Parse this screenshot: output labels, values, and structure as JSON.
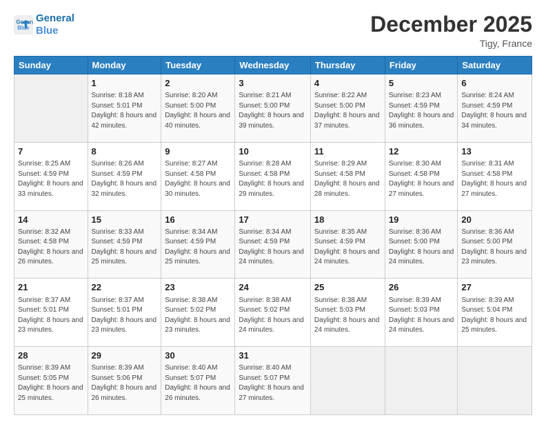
{
  "header": {
    "logo_line1": "General",
    "logo_line2": "Blue",
    "month": "December 2025",
    "location": "Tigy, France"
  },
  "weekdays": [
    "Sunday",
    "Monday",
    "Tuesday",
    "Wednesday",
    "Thursday",
    "Friday",
    "Saturday"
  ],
  "weeks": [
    [
      {
        "day": "",
        "sunrise": "",
        "sunset": "",
        "daylight": ""
      },
      {
        "day": "1",
        "sunrise": "8:18 AM",
        "sunset": "5:01 PM",
        "daylight": "8 hours and 42 minutes."
      },
      {
        "day": "2",
        "sunrise": "8:20 AM",
        "sunset": "5:00 PM",
        "daylight": "8 hours and 40 minutes."
      },
      {
        "day": "3",
        "sunrise": "8:21 AM",
        "sunset": "5:00 PM",
        "daylight": "8 hours and 39 minutes."
      },
      {
        "day": "4",
        "sunrise": "8:22 AM",
        "sunset": "5:00 PM",
        "daylight": "8 hours and 37 minutes."
      },
      {
        "day": "5",
        "sunrise": "8:23 AM",
        "sunset": "4:59 PM",
        "daylight": "8 hours and 36 minutes."
      },
      {
        "day": "6",
        "sunrise": "8:24 AM",
        "sunset": "4:59 PM",
        "daylight": "8 hours and 34 minutes."
      }
    ],
    [
      {
        "day": "7",
        "sunrise": "8:25 AM",
        "sunset": "4:59 PM",
        "daylight": "8 hours and 33 minutes."
      },
      {
        "day": "8",
        "sunrise": "8:26 AM",
        "sunset": "4:59 PM",
        "daylight": "8 hours and 32 minutes."
      },
      {
        "day": "9",
        "sunrise": "8:27 AM",
        "sunset": "4:58 PM",
        "daylight": "8 hours and 30 minutes."
      },
      {
        "day": "10",
        "sunrise": "8:28 AM",
        "sunset": "4:58 PM",
        "daylight": "8 hours and 29 minutes."
      },
      {
        "day": "11",
        "sunrise": "8:29 AM",
        "sunset": "4:58 PM",
        "daylight": "8 hours and 28 minutes."
      },
      {
        "day": "12",
        "sunrise": "8:30 AM",
        "sunset": "4:58 PM",
        "daylight": "8 hours and 27 minutes."
      },
      {
        "day": "13",
        "sunrise": "8:31 AM",
        "sunset": "4:58 PM",
        "daylight": "8 hours and 27 minutes."
      }
    ],
    [
      {
        "day": "14",
        "sunrise": "8:32 AM",
        "sunset": "4:58 PM",
        "daylight": "8 hours and 26 minutes."
      },
      {
        "day": "15",
        "sunrise": "8:33 AM",
        "sunset": "4:59 PM",
        "daylight": "8 hours and 25 minutes."
      },
      {
        "day": "16",
        "sunrise": "8:34 AM",
        "sunset": "4:59 PM",
        "daylight": "8 hours and 25 minutes."
      },
      {
        "day": "17",
        "sunrise": "8:34 AM",
        "sunset": "4:59 PM",
        "daylight": "8 hours and 24 minutes."
      },
      {
        "day": "18",
        "sunrise": "8:35 AM",
        "sunset": "4:59 PM",
        "daylight": "8 hours and 24 minutes."
      },
      {
        "day": "19",
        "sunrise": "8:36 AM",
        "sunset": "5:00 PM",
        "daylight": "8 hours and 24 minutes."
      },
      {
        "day": "20",
        "sunrise": "8:36 AM",
        "sunset": "5:00 PM",
        "daylight": "8 hours and 23 minutes."
      }
    ],
    [
      {
        "day": "21",
        "sunrise": "8:37 AM",
        "sunset": "5:01 PM",
        "daylight": "8 hours and 23 minutes."
      },
      {
        "day": "22",
        "sunrise": "8:37 AM",
        "sunset": "5:01 PM",
        "daylight": "8 hours and 23 minutes."
      },
      {
        "day": "23",
        "sunrise": "8:38 AM",
        "sunset": "5:02 PM",
        "daylight": "8 hours and 23 minutes."
      },
      {
        "day": "24",
        "sunrise": "8:38 AM",
        "sunset": "5:02 PM",
        "daylight": "8 hours and 24 minutes."
      },
      {
        "day": "25",
        "sunrise": "8:38 AM",
        "sunset": "5:03 PM",
        "daylight": "8 hours and 24 minutes."
      },
      {
        "day": "26",
        "sunrise": "8:39 AM",
        "sunset": "5:03 PM",
        "daylight": "8 hours and 24 minutes."
      },
      {
        "day": "27",
        "sunrise": "8:39 AM",
        "sunset": "5:04 PM",
        "daylight": "8 hours and 25 minutes."
      }
    ],
    [
      {
        "day": "28",
        "sunrise": "8:39 AM",
        "sunset": "5:05 PM",
        "daylight": "8 hours and 25 minutes."
      },
      {
        "day": "29",
        "sunrise": "8:39 AM",
        "sunset": "5:06 PM",
        "daylight": "8 hours and 26 minutes."
      },
      {
        "day": "30",
        "sunrise": "8:40 AM",
        "sunset": "5:07 PM",
        "daylight": "8 hours and 26 minutes."
      },
      {
        "day": "31",
        "sunrise": "8:40 AM",
        "sunset": "5:07 PM",
        "daylight": "8 hours and 27 minutes."
      },
      {
        "day": "",
        "sunrise": "",
        "sunset": "",
        "daylight": ""
      },
      {
        "day": "",
        "sunrise": "",
        "sunset": "",
        "daylight": ""
      },
      {
        "day": "",
        "sunrise": "",
        "sunset": "",
        "daylight": ""
      }
    ]
  ]
}
